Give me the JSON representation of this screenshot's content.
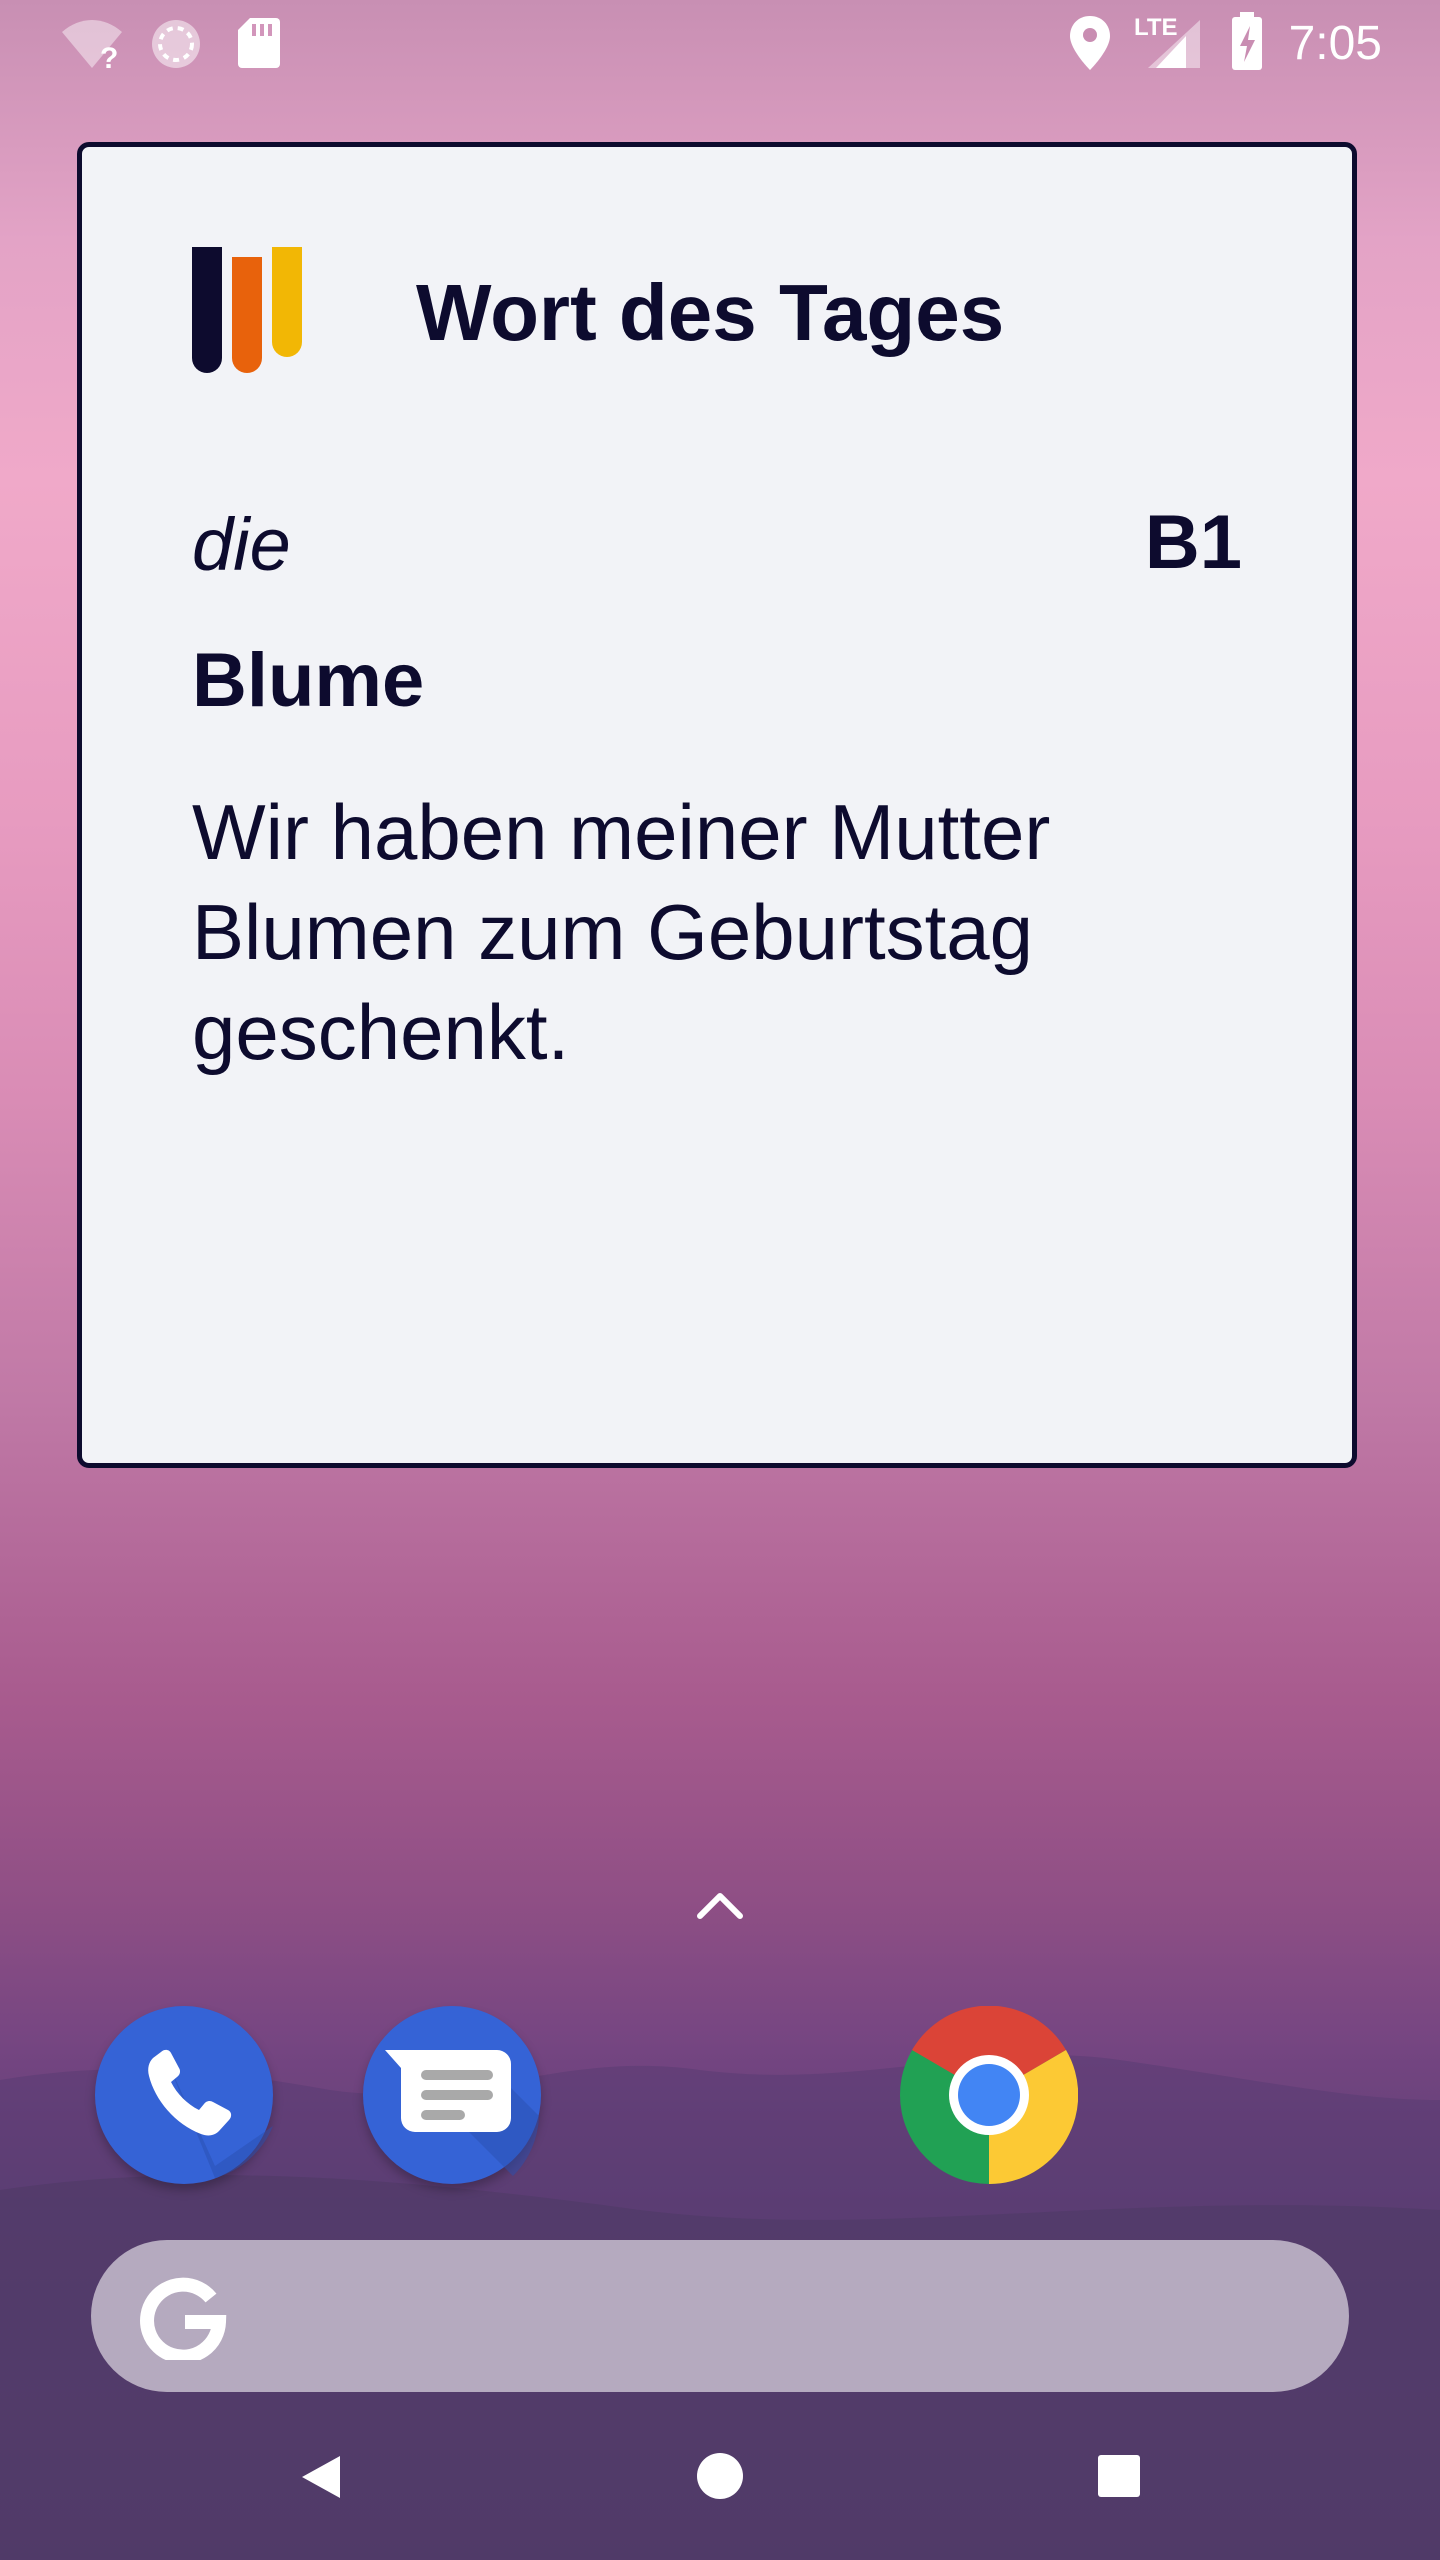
{
  "status_bar": {
    "time": "7:05",
    "network_label": "LTE",
    "icons": [
      "wifi-unknown-icon",
      "sync-icon",
      "sd-card-icon",
      "location-icon",
      "cell-signal-icon",
      "battery-charging-icon"
    ]
  },
  "widget": {
    "title": "Wort des Tages",
    "article": "die",
    "level": "B1",
    "word": "Blume",
    "sentence": "Wir haben meiner Mutter Blumen zum Geburtstag geschenkt.",
    "logo_colors": [
      "#0d0b2e",
      "#e8620c",
      "#f2b705"
    ]
  },
  "dock": {
    "apps": [
      "phone-app-icon",
      "messages-app-icon",
      "chrome-app-icon"
    ]
  },
  "search": {
    "placeholder": ""
  },
  "nav": {
    "buttons": [
      "back-button",
      "home-button",
      "recents-button"
    ]
  }
}
